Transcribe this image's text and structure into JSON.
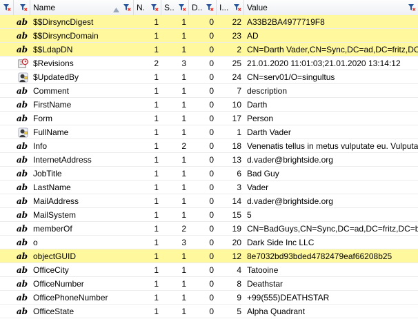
{
  "columns": {
    "name": "Name",
    "n": "N.",
    "s": "S..",
    "d": "D..",
    "l": "I...",
    "value": "Value"
  },
  "rows": [
    {
      "type": "ab",
      "name": "$$DirsyncDigest",
      "n": "1",
      "s": "1",
      "d": "0",
      "l": "22",
      "value": "A33B2BA4977719F8",
      "hl": true
    },
    {
      "type": "ab",
      "name": "$$DirsyncDomain",
      "n": "1",
      "s": "1",
      "d": "0",
      "l": "23",
      "value": "AD",
      "hl": true
    },
    {
      "type": "ab",
      "name": "$$LdapDN",
      "n": "1",
      "s": "1",
      "d": "0",
      "l": "2",
      "value": "CN=Darth Vader,CN=Sync,DC=ad,DC=fritz,DC",
      "hl": true
    },
    {
      "type": "clock",
      "name": "$Revisions",
      "n": "2",
      "s": "3",
      "d": "0",
      "l": "25",
      "value": "21.01.2020 11:01:03;21.01.2020 13:14:12",
      "hl": false
    },
    {
      "type": "person",
      "name": "$UpdatedBy",
      "n": "1",
      "s": "1",
      "d": "0",
      "l": "24",
      "value": "CN=serv01/O=singultus",
      "hl": false
    },
    {
      "type": "ab",
      "name": "Comment",
      "n": "1",
      "s": "1",
      "d": "0",
      "l": "7",
      "value": "description",
      "hl": false
    },
    {
      "type": "ab",
      "name": "FirstName",
      "n": "1",
      "s": "1",
      "d": "0",
      "l": "10",
      "value": "Darth",
      "hl": false
    },
    {
      "type": "ab",
      "name": "Form",
      "n": "1",
      "s": "1",
      "d": "0",
      "l": "17",
      "value": "Person",
      "hl": false
    },
    {
      "type": "person",
      "name": "FullName",
      "n": "1",
      "s": "1",
      "d": "0",
      "l": "1",
      "value": "Darth Vader",
      "hl": false
    },
    {
      "type": "ab",
      "name": "Info",
      "n": "1",
      "s": "2",
      "d": "0",
      "l": "18",
      "value": "Venenatis tellus in metus vulputate eu. Vulputa",
      "hl": false
    },
    {
      "type": "ab",
      "name": "InternetAddress",
      "n": "1",
      "s": "1",
      "d": "0",
      "l": "13",
      "value": "d.vader@brightside.org",
      "hl": false
    },
    {
      "type": "ab",
      "name": "JobTitle",
      "n": "1",
      "s": "1",
      "d": "0",
      "l": "6",
      "value": "Bad Guy",
      "hl": false
    },
    {
      "type": "ab",
      "name": "LastName",
      "n": "1",
      "s": "1",
      "d": "0",
      "l": "3",
      "value": "Vader",
      "hl": false
    },
    {
      "type": "ab",
      "name": "MailAddress",
      "n": "1",
      "s": "1",
      "d": "0",
      "l": "14",
      "value": "d.vader@brightside.org",
      "hl": false
    },
    {
      "type": "ab",
      "name": "MailSystem",
      "n": "1",
      "s": "1",
      "d": "0",
      "l": "15",
      "value": "5",
      "hl": false
    },
    {
      "type": "ab",
      "name": "memberOf",
      "n": "1",
      "s": "2",
      "d": "0",
      "l": "19",
      "value": "CN=BadGuys,CN=Sync,DC=ad,DC=fritz,DC=b",
      "hl": false
    },
    {
      "type": "ab",
      "name": "o",
      "n": "1",
      "s": "3",
      "d": "0",
      "l": "20",
      "value": "Dark Side Inc LLC",
      "hl": false
    },
    {
      "type": "ab",
      "name": "objectGUID",
      "n": "1",
      "s": "1",
      "d": "0",
      "l": "12",
      "value": "8e7032bd93bded4782479eaf66208b25",
      "hl": true
    },
    {
      "type": "ab",
      "name": "OfficeCity",
      "n": "1",
      "s": "1",
      "d": "0",
      "l": "4",
      "value": "Tatooine",
      "hl": false
    },
    {
      "type": "ab",
      "name": "OfficeNumber",
      "n": "1",
      "s": "1",
      "d": "0",
      "l": "8",
      "value": "Deathstar",
      "hl": false
    },
    {
      "type": "ab",
      "name": "OfficePhoneNumber",
      "n": "1",
      "s": "1",
      "d": "0",
      "l": "9",
      "value": "+99(555)DEATHSTAR",
      "hl": false
    },
    {
      "type": "ab",
      "name": "OfficeState",
      "n": "1",
      "s": "1",
      "d": "0",
      "l": "5",
      "value": "Alpha Quadrant",
      "hl": false
    }
  ],
  "icons": {
    "text": "ab",
    "clock": "clock-icon",
    "person": "person-icon",
    "filter": "filter-icon",
    "sort": "sort-asc-icon"
  },
  "colors": {
    "highlight": "#fff89c",
    "filter_blue": "#2b579a",
    "filter_red": "#e0322a"
  }
}
